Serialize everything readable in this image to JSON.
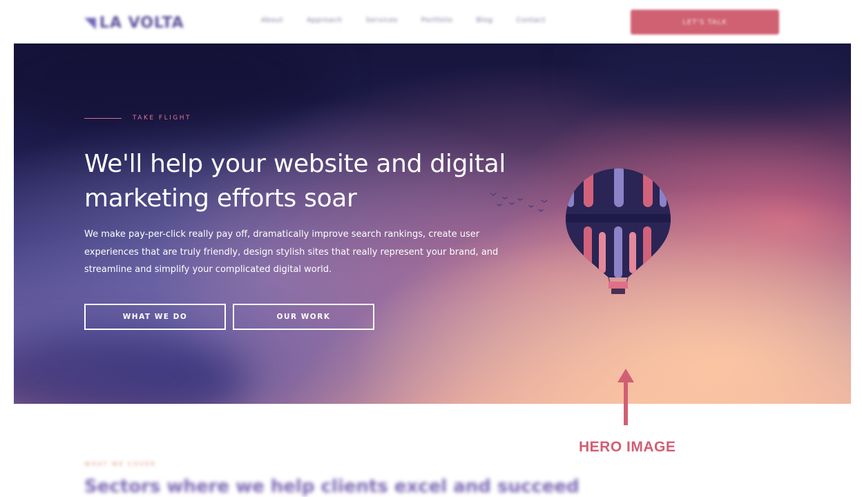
{
  "nav": {
    "logo_text": "LA VOLTA",
    "links": [
      "About",
      "Approach",
      "Services",
      "Portfolio",
      "Blog",
      "Contact"
    ],
    "cta_label": "LET'S TALK"
  },
  "hero": {
    "eyebrow": "TAKE FLIGHT",
    "headline": "We'll help your website and digital marketing efforts soar",
    "body": "We make pay-per-click really pay off, dramatically improve search rankings, create user experiences that are truly friendly, design stylish sites that really represent your brand, and streamline and simplify your complicated digital world.",
    "buttons": [
      "WHAT WE DO",
      "OUR WORK"
    ]
  },
  "annotation": {
    "label": "HERO IMAGE",
    "color": "#d15f74"
  },
  "below_fold": {
    "eyebrow": "WHAT WE COVER",
    "heading": "Sectors where we help clients excel and succeed"
  },
  "icons": [
    "balloon-illustration",
    "birds-illustration",
    "arrow-up-icon"
  ]
}
